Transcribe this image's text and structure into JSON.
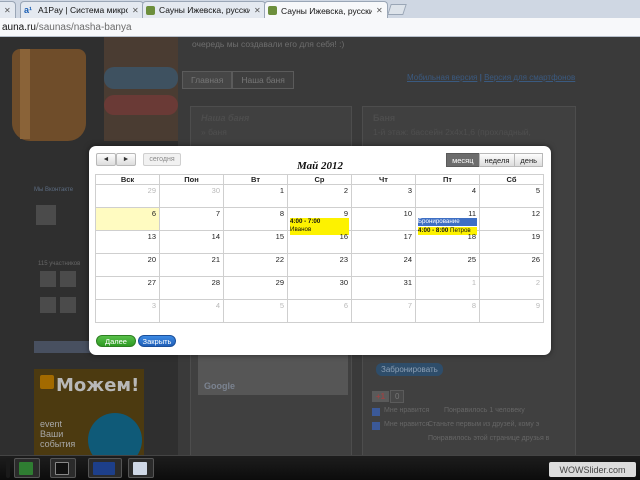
{
  "browser": {
    "tabs": [
      {
        "title": "A1Pay | Система микропл",
        "icon": "a1pay-icon"
      },
      {
        "title": "Сауны Ижевска, русские,",
        "icon": "sauna-site-icon"
      },
      {
        "title": "Сауны Ижевска, русские, ",
        "icon": "sauna-site-icon",
        "active": true
      }
    ],
    "first_tab_stub": "a",
    "url_host": "auna.ru",
    "url_path": "/saunas/nasha-banya"
  },
  "page": {
    "top_note": "очередь мы создавали его для себя! :)",
    "nav_tabs": [
      "Главная",
      "Наша баня"
    ],
    "mobile_link": "Мобильная версия",
    "mobile_sep": " | ",
    "smartphone_link": "Версия для смартфонов",
    "panel1_title": "Наша баня",
    "panel1_item": "баня",
    "panel2_title": "Баня",
    "panel2_text": "1-й этаж: бассейн 2х4х1,6 (прохладный,",
    "left_widget_title": "Мы Вконтакте",
    "left_members": "115 участников",
    "ad_brand": "Можем!",
    "ad_event": "event",
    "ad_sub1": "Ваши",
    "ad_sub2": "события",
    "map_brand": "Google",
    "book_button": "Забронировать",
    "gplus": "+1",
    "gplus_count": "0",
    "like_text": "Мне нравится",
    "like_count": "Понравилось 1 человеку",
    "recommend_text": "Мне нравится",
    "recommend_hint": "Станьте первым из друзей, кому э",
    "share_text": "Понравилось этой странице друзья в"
  },
  "calendar": {
    "title": "Май 2012",
    "prev_label": "◄",
    "next_label": "►",
    "today_label": "сегодня",
    "views": [
      {
        "label": "месяц",
        "active": true
      },
      {
        "label": "неделя",
        "active": false
      },
      {
        "label": "день",
        "active": false
      }
    ],
    "weekdays": [
      "Вск",
      "Пон",
      "Вт",
      "Ср",
      "Чт",
      "Пт",
      "Сб"
    ],
    "weeks": [
      [
        {
          "d": "29",
          "other": true
        },
        {
          "d": "30",
          "other": true
        },
        {
          "d": "1"
        },
        {
          "d": "2"
        },
        {
          "d": "3"
        },
        {
          "d": "4"
        },
        {
          "d": "5"
        }
      ],
      [
        {
          "d": "6",
          "today": true
        },
        {
          "d": "7"
        },
        {
          "d": "8"
        },
        {
          "d": "9",
          "events": [
            {
              "time": "4:00 - 7:00",
              "text": "Иванов",
              "color": "yellow"
            }
          ]
        },
        {
          "d": "10"
        },
        {
          "d": "11",
          "events": [
            {
              "time": "",
              "text": "Бронирование",
              "color": "blue"
            },
            {
              "time": "4:00 - 8:00",
              "text": "Петров",
              "color": "yellow"
            }
          ]
        },
        {
          "d": "12"
        }
      ],
      [
        {
          "d": "13"
        },
        {
          "d": "14"
        },
        {
          "d": "15"
        },
        {
          "d": "16"
        },
        {
          "d": "17"
        },
        {
          "d": "18"
        },
        {
          "d": "19"
        }
      ],
      [
        {
          "d": "20"
        },
        {
          "d": "21"
        },
        {
          "d": "22"
        },
        {
          "d": "23"
        },
        {
          "d": "24"
        },
        {
          "d": "25"
        },
        {
          "d": "26"
        }
      ],
      [
        {
          "d": "27"
        },
        {
          "d": "28"
        },
        {
          "d": "29"
        },
        {
          "d": "30"
        },
        {
          "d": "31"
        },
        {
          "d": "1",
          "other": true
        },
        {
          "d": "2",
          "other": true
        }
      ],
      [
        {
          "d": "3",
          "other": true
        },
        {
          "d": "4",
          "other": true
        },
        {
          "d": "5",
          "other": true
        },
        {
          "d": "6",
          "other": true
        },
        {
          "d": "7",
          "other": true
        },
        {
          "d": "8",
          "other": true
        },
        {
          "d": "9",
          "other": true
        }
      ]
    ],
    "next_button": "Далее",
    "close_button": "Закрыть",
    "colors": {
      "event_yellow": "#fdf200",
      "event_blue": "#3e6fc4",
      "today_bg": "#fffbc1"
    }
  },
  "taskbar": {
    "items": [
      "excel-icon",
      "terminal-icon",
      "calculator-icon",
      "notepad-icon"
    ],
    "watermark": "WOWSlider.com"
  }
}
